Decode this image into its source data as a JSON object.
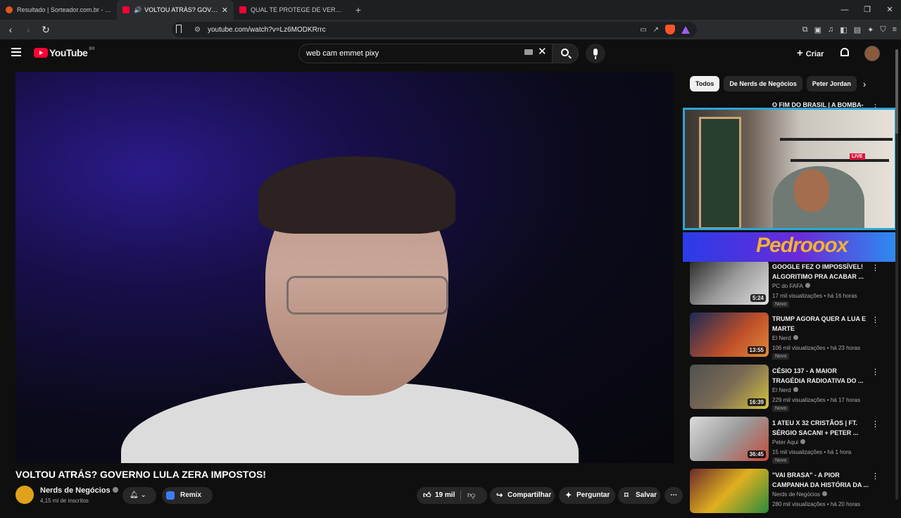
{
  "browser": {
    "tabs": [
      {
        "title": "Resultado | Sorteador.com.br - O Site...",
        "icon": "sorteador-favicon"
      },
      {
        "title": "VOLTOU ATRÁS? GOVERNO L...",
        "icon": "youtube-favicon",
        "active": true
      },
      {
        "title": "QUAL TE PROTEGE DE VERDADE? Tes...",
        "icon": "youtube-favicon"
      }
    ],
    "new_tab": "+",
    "url": "youtube.com/watch?v=Lz6MODKRrrc",
    "window_controls": [
      "—",
      "❐",
      "✕"
    ]
  },
  "youtube": {
    "logo_text": "YouTube",
    "country_code": "BR",
    "search_value": "web cam emmet pixy",
    "create_label": "Criar"
  },
  "video": {
    "title": "VOLTOU ATRÁS? GOVERNO LULA ZERA IMPOSTOS!",
    "channel": "Nerds de Negócios",
    "subscribers": "4,15 mi de inscritos",
    "remix_label": "Remix",
    "likes": "19 mil",
    "share_label": "Compartilhar",
    "ask_label": "Perguntar",
    "save_label": "Salvar",
    "more_label": "⋯"
  },
  "sidebar": {
    "chips": [
      "Todos",
      "De Nerds de Negócios",
      "Peter Jordan"
    ],
    "first_title": "O FIM DO BRASIL | A BOMBA-",
    "webcam_live": "LIVE",
    "overlay_text": "Pedrooox",
    "recommendations": [
      {
        "title": "GOOGLE FEZ O IMPOSSÍVEL! ALGORITIMO PRA ACABAR ...",
        "channel": "PC do FAFA",
        "meta": "17 mil visualizações • há 16 horas",
        "badge": "Novo",
        "duration": "5:24",
        "thumb": "linear-gradient(135deg,#2d2d2d,#9a9a9a 50%,#e0e0e0)"
      },
      {
        "title": "TRUMP AGORA QUER A LUA E MARTE",
        "channel": "El Nerd",
        "meta": "106 mil visualizações • há 23 horas",
        "badge": "Novo",
        "duration": "13:55",
        "thumb": "linear-gradient(135deg,#1b2a55,#c0502a 60%,#e08a3a)"
      },
      {
        "title": "CÉSIO 137 - A MAIOR TRAGÉDIA RADIOATIVA DO ...",
        "channel": "El Nerd",
        "meta": "229 mil visualizações • há 17 horas",
        "badge": "Novo",
        "duration": "16:39",
        "thumb": "linear-gradient(135deg,#505050,#7a6a55 50%,#d6c340)"
      },
      {
        "title": "1 ATEU X 32 CRISTÃOS | FT. SÉRGIO SACANI + PETER ...",
        "channel": "Peter Aqui",
        "meta": "15 mil visualizações • há 1 hora",
        "badge": "Novo",
        "duration": "36:45",
        "thumb": "linear-gradient(135deg,#dcdcdc,#9a9a9a 50%,#c24a3a)"
      },
      {
        "title": "\"VAI BRASA\" - A PIOR CAMPANHA DA HISTÓRIA DA ...",
        "channel": "Nerds de Negócios",
        "meta": "280 mil visualizações • há 20 horas",
        "badge": "",
        "duration": "",
        "thumb": "linear-gradient(135deg,#6b2a2a,#e0b020 50%,#2a8a3a)"
      }
    ]
  }
}
